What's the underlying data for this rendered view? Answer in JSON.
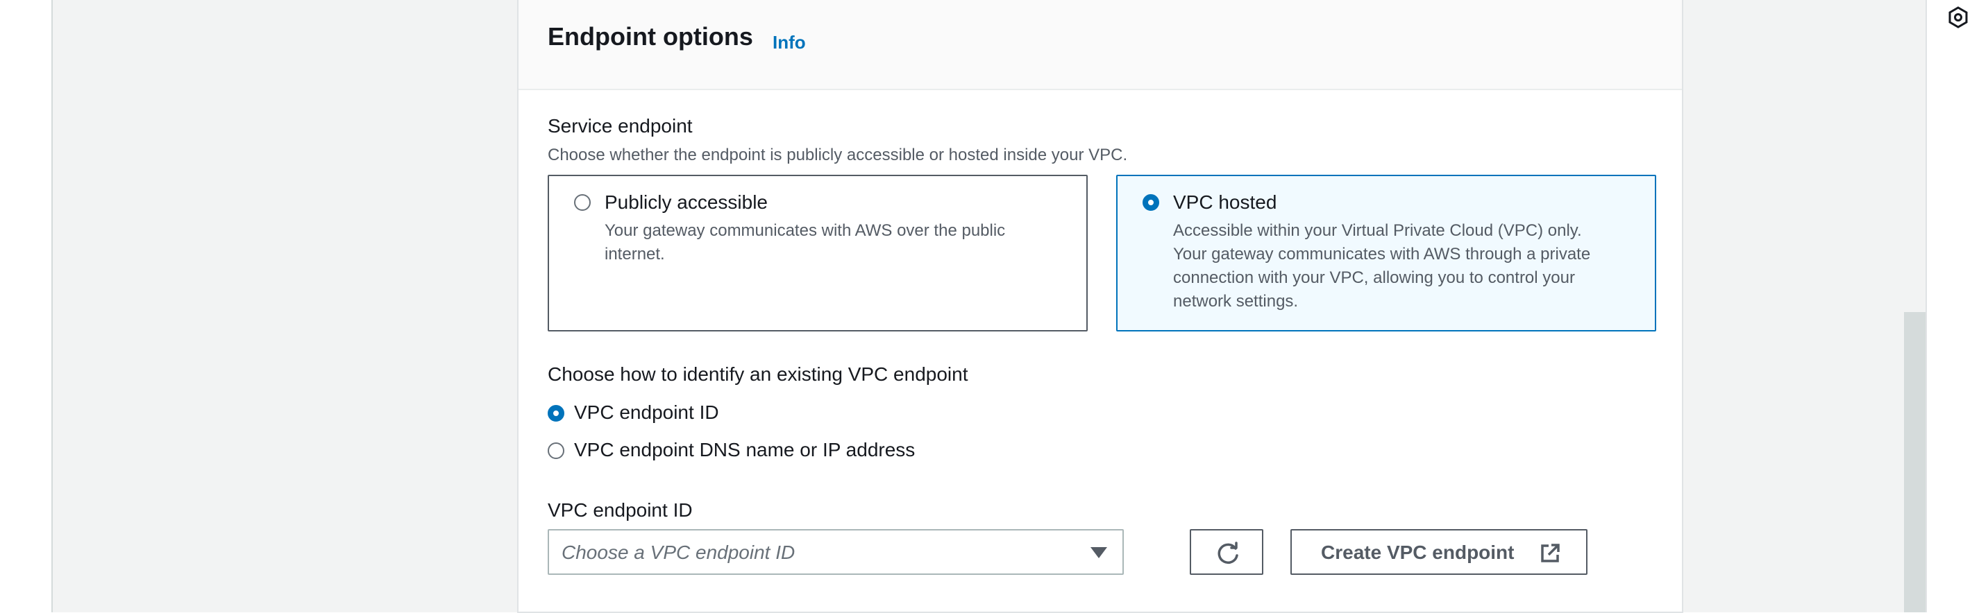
{
  "panel": {
    "title": "Endpoint options",
    "info_link": "Info"
  },
  "service_endpoint": {
    "label": "Service endpoint",
    "description": "Choose whether the endpoint is publicly accessible or hosted inside your VPC.",
    "options": [
      {
        "title": "Publicly accessible",
        "desc_lines": [
          "Your gateway communicates with AWS over the public",
          "internet."
        ],
        "selected": false
      },
      {
        "title": "VPC hosted",
        "desc_lines": [
          "Accessible within your Virtual Private Cloud (VPC) only.",
          "Your gateway communicates with AWS through a private",
          "connection with your VPC, allowing you to control your",
          "network settings."
        ],
        "selected": true
      }
    ]
  },
  "identify": {
    "label": "Choose how to identify an existing VPC endpoint",
    "options": [
      {
        "label": "VPC endpoint ID",
        "selected": true
      },
      {
        "label": "VPC endpoint DNS name or IP address",
        "selected": false
      }
    ]
  },
  "endpoint_id": {
    "label": "VPC endpoint ID",
    "placeholder": "Choose a VPC endpoint ID",
    "create_button": "Create VPC endpoint"
  },
  "icons": {
    "dropdown": "caret-down-icon",
    "refresh": "refresh-icon",
    "external": "external-link-icon",
    "rail": "hexagon-icon"
  },
  "colors": {
    "accent": "#0073bb",
    "selected_tile_bg": "#f1faff",
    "text": "#16191f",
    "secondary_text": "#545b64"
  }
}
